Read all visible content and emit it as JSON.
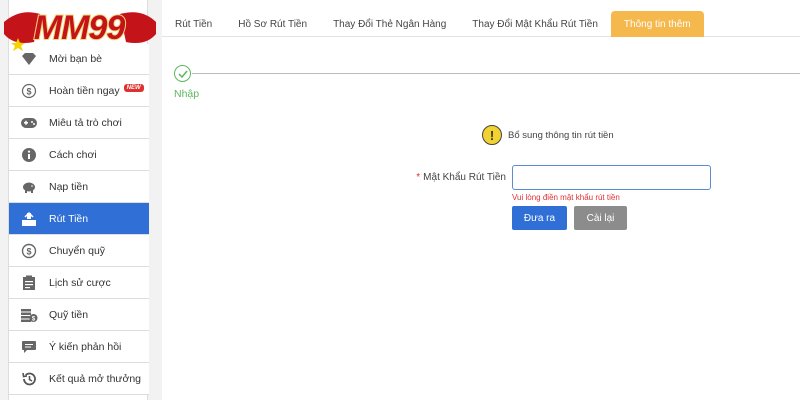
{
  "brand": {
    "logo_text": "MM99"
  },
  "sidebar": {
    "items": [
      {
        "label": "Mời bạn bè",
        "icon": "diamond-icon"
      },
      {
        "label": "Hoàn tiền ngay",
        "icon": "cashback-icon",
        "badge": "NEW"
      },
      {
        "label": "Miêu tả trò chơi",
        "icon": "gamepad-icon"
      },
      {
        "label": "Cách chơi",
        "icon": "info-icon"
      },
      {
        "label": "Nạp tiền",
        "icon": "piggy-bank-icon"
      },
      {
        "label": "Rút Tiền",
        "icon": "withdraw-icon",
        "active": true
      },
      {
        "label": "Chuyển quỹ",
        "icon": "transfer-icon"
      },
      {
        "label": "Lịch sử cược",
        "icon": "clipboard-icon"
      },
      {
        "label": "Quỹ tiền",
        "icon": "coins-icon"
      },
      {
        "label": "Ý kiến phản hồi",
        "icon": "chat-icon"
      },
      {
        "label": "Kết quả mở thưởng",
        "icon": "history-icon"
      }
    ]
  },
  "tabs": [
    {
      "label": "Rút Tiền"
    },
    {
      "label": "Hồ Sơ Rút Tiền"
    },
    {
      "label": "Thay Đổi Thẻ Ngân Hàng"
    },
    {
      "label": "Thay Đổi Mật Khẩu Rút Tiền"
    },
    {
      "label": "Thông tin thêm",
      "active": true
    }
  ],
  "step": {
    "label": "Nhập"
  },
  "notice": {
    "text": "Bổ sung thông tin rút tiền"
  },
  "form": {
    "required_mark": "*",
    "password_label": "Mật Khẩu Rút Tiền",
    "password_value": "",
    "error_text": "Vui lòng điền mật khẩu rút tiền",
    "submit_label": "Đưa ra",
    "reset_label": "Cài lại"
  },
  "colors": {
    "active_blue": "#2f6fd6",
    "tab_orange": "#f5b84d",
    "success_green": "#5cb85c",
    "error_red": "#e03131",
    "reset_gray": "#8c8c8c"
  }
}
